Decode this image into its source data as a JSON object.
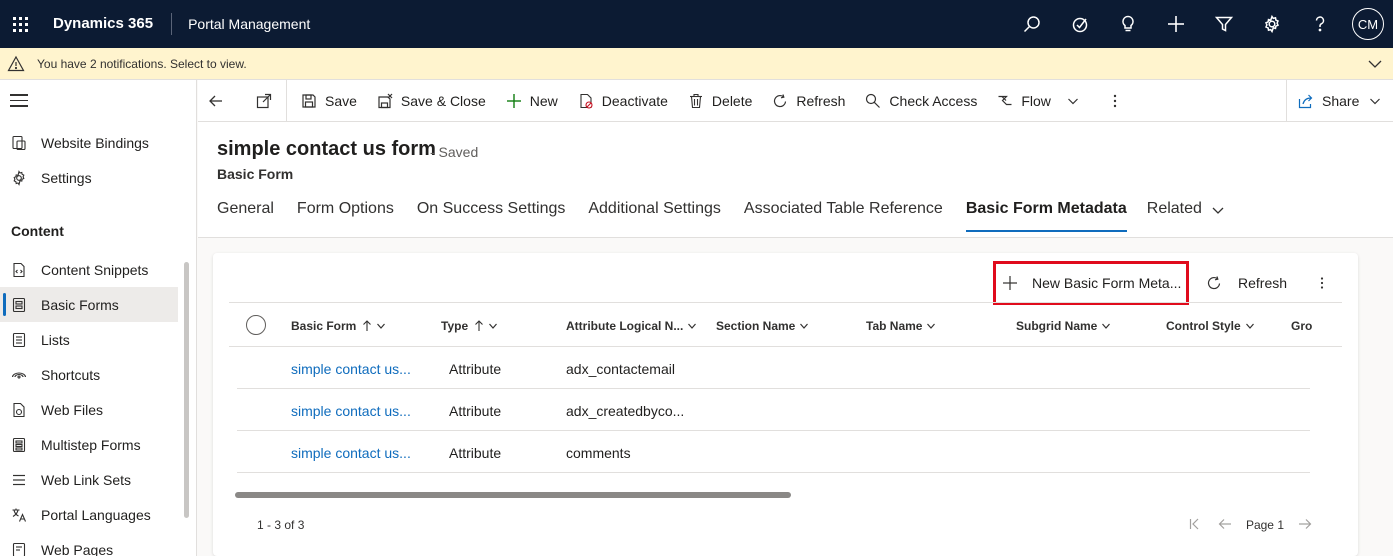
{
  "topbar": {
    "brand": "Dynamics 365",
    "app": "Portal Management",
    "avatar_initials": "CM",
    "icons": [
      "search-icon",
      "task-icon",
      "lightbulb-icon",
      "plus-icon",
      "filter-icon",
      "gear-icon",
      "help-icon"
    ]
  },
  "notification": {
    "text": "You have 2 notifications. Select to view."
  },
  "sidebar": {
    "items_top": [
      {
        "label": "Website Bindings",
        "icon": "binding-icon"
      },
      {
        "label": "Settings",
        "icon": "gear-icon"
      }
    ],
    "section": "Content",
    "items": [
      {
        "label": "Content Snippets",
        "icon": "snippet-icon"
      },
      {
        "label": "Basic Forms",
        "icon": "form-icon",
        "active": true
      },
      {
        "label": "Lists",
        "icon": "list-icon"
      },
      {
        "label": "Shortcuts",
        "icon": "shortcut-icon"
      },
      {
        "label": "Web Files",
        "icon": "file-icon"
      },
      {
        "label": "Multistep Forms",
        "icon": "multistep-icon"
      },
      {
        "label": "Web Link Sets",
        "icon": "linkset-icon"
      },
      {
        "label": "Portal Languages",
        "icon": "language-icon"
      },
      {
        "label": "Web Pages",
        "icon": "page-icon"
      }
    ]
  },
  "commandbar": {
    "save": "Save",
    "save_close": "Save & Close",
    "new": "New",
    "deactivate": "Deactivate",
    "delete": "Delete",
    "refresh": "Refresh",
    "check_access": "Check Access",
    "flow": "Flow",
    "share": "Share"
  },
  "record": {
    "title": "simple contact us form",
    "saved": "- Saved",
    "entity": "Basic Form"
  },
  "tabs": [
    {
      "label": "General"
    },
    {
      "label": "Form Options"
    },
    {
      "label": "On Success Settings"
    },
    {
      "label": "Additional Settings"
    },
    {
      "label": "Associated Table Reference"
    },
    {
      "label": "Basic Form Metadata",
      "active": true
    },
    {
      "label": "Related"
    }
  ],
  "grid": {
    "new_button": "New Basic Form Meta...",
    "refresh": "Refresh",
    "columns": [
      "Basic Form",
      "Type",
      "Attribute Logical N...",
      "Section Name",
      "Tab Name",
      "Subgrid Name",
      "Control Style",
      "Gro"
    ],
    "rows": [
      {
        "basic_form": "simple contact us...",
        "type": "Attribute",
        "attribute": "adx_contactemail"
      },
      {
        "basic_form": "simple contact us...",
        "type": "Attribute",
        "attribute": "adx_createdbyco..."
      },
      {
        "basic_form": "simple contact us...",
        "type": "Attribute",
        "attribute": "comments"
      }
    ],
    "record_count": "1 - 3 of 3",
    "page": "Page 1"
  },
  "colors": {
    "topbar": "#0c1b33",
    "notification": "#fff4ce",
    "accent": "#0f6cbd",
    "highlight_border": "#e00b1c"
  }
}
